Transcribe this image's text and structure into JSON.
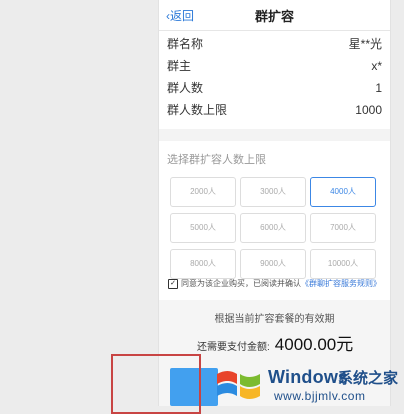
{
  "nav": {
    "back_label": "返回",
    "title": "群扩容"
  },
  "group_info": [
    {
      "label": "群名称",
      "value": "星**光"
    },
    {
      "label": "群主",
      "value": "x*"
    },
    {
      "label": "群人数",
      "value": "1"
    },
    {
      "label": "群人数上限",
      "value": "1000"
    }
  ],
  "select_title": "选择群扩容人数上限",
  "options": [
    "2000人",
    "3000人",
    "4000人",
    "5000人",
    "6000人",
    "7000人",
    "8000人",
    "9000人",
    "10000人"
  ],
  "selected_option": "4000人",
  "agreement": {
    "checked": true,
    "text": "同意为该企业购买，已阅读并确认",
    "link": "《群聊扩容服务规则》"
  },
  "payment": {
    "validity_text": "根据当前扩容套餐的有效期",
    "amount_label": "还需要支付金额:",
    "amount": "4000.00元"
  },
  "colors": {
    "accent": "#3c87e5",
    "pay_button": "#42a0ef",
    "highlight_box": "#c84443"
  },
  "watermark": {
    "brand": "Windows",
    "cn": "系统之家",
    "url": "www.bjjmlv.com"
  }
}
